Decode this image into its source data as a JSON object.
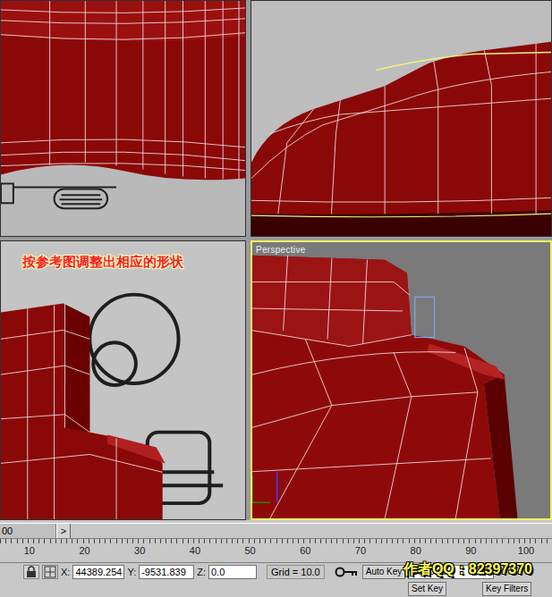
{
  "viewports": [
    {
      "label": null,
      "active": false,
      "annotation": null
    },
    {
      "label": null,
      "active": false,
      "annotation": null
    },
    {
      "label": null,
      "active": false,
      "annotation": "按参考图调整出相应的形状"
    },
    {
      "label": "Perspective",
      "active": true,
      "annotation": null
    }
  ],
  "timeline": {
    "frame": "00",
    "next": ">"
  },
  "ruler": {
    "ticks": [
      "10",
      "20",
      "30",
      "40",
      "50",
      "60",
      "70",
      "80",
      "90",
      "100"
    ]
  },
  "status": {
    "x_label": "X:",
    "x": "44389.254",
    "y_label": "Y:",
    "y": "-9531.839",
    "z_label": "Z:",
    "z": "0.0",
    "grid": "Grid = 10.0"
  },
  "key_controls": {
    "auto_key": "Auto Key",
    "selection": "Selected",
    "set_key": "Set Key",
    "key_filters": "Key Filters"
  },
  "watermark": "作者QQ：82397370"
}
